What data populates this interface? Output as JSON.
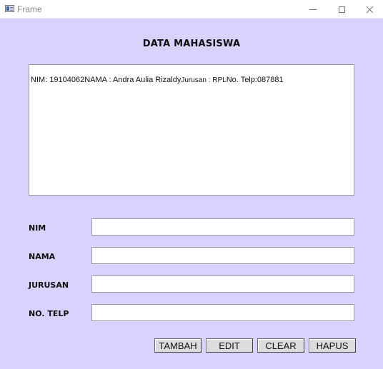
{
  "window": {
    "title": "Frame",
    "app_icon": "java-frame-icon",
    "controls": [
      "minimize-icon",
      "maximize-icon",
      "close-icon"
    ]
  },
  "heading": "DATA MAHASISWA",
  "output": {
    "nim_text": "NIM: 19104062",
    "nama_text": "NAMA : Andra Aulia Rizaldy",
    "jurusan_text": "Jurusan : RPL",
    "telp_text": "No. Telp:087881"
  },
  "form": {
    "nim": {
      "label": "NIM",
      "value": ""
    },
    "nama": {
      "label": "NAMA",
      "value": ""
    },
    "jurusan": {
      "label": "JURUSAN",
      "value": ""
    },
    "notelp": {
      "label": "NO. TELP",
      "value": ""
    }
  },
  "buttons": {
    "tambah": "TAMBAH",
    "edit": "EDIT",
    "clear": "CLEAR",
    "hapus": "HAPUS"
  },
  "colors": {
    "background": "#d8d2fc",
    "button": "#dcdcdc",
    "titlebar": "#ffffff"
  }
}
